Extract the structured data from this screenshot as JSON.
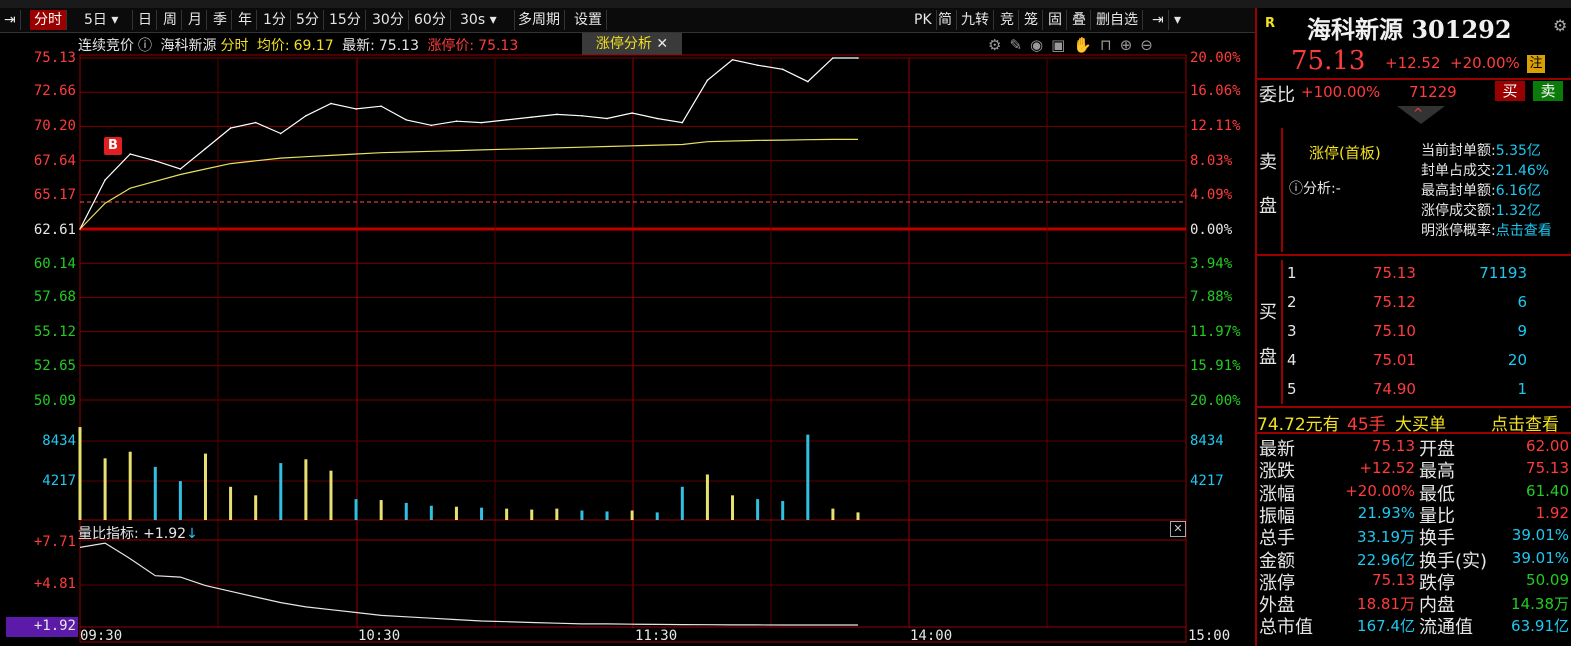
{
  "toolbar": {
    "items": [
      "分时",
      "5日",
      "日",
      "周",
      "月",
      "季",
      "年",
      "1分",
      "5分",
      "15分",
      "30分",
      "60分",
      "30s",
      "多周期",
      "设置"
    ],
    "right_items": [
      "PK",
      "简",
      "九转",
      "竞",
      "笼",
      "固",
      "叠",
      "删自选"
    ]
  },
  "infobar": {
    "auction": "连续竞价",
    "stock_name": "海科新源",
    "mode": "分时",
    "avg_label": "均价:",
    "avg_value": "69.17",
    "last_label": "最新:",
    "last_value": "75.13",
    "limit_label": "涨停价:",
    "limit_value": "75.13",
    "tab_label": "涨停分析"
  },
  "price_axis": {
    "left": [
      "75.13",
      "72.66",
      "70.20",
      "67.64",
      "65.17",
      "62.61",
      "60.14",
      "57.68",
      "55.12",
      "52.65",
      "50.09"
    ],
    "right": [
      "20.00%",
      "16.06%",
      "12.11%",
      "8.03%",
      "4.09%",
      "0.00%",
      "3.94%",
      "7.88%",
      "11.97%",
      "15.91%",
      "20.00%"
    ]
  },
  "volume_axis": {
    "left": [
      "8434",
      "4217"
    ],
    "right": [
      "8434",
      "4217"
    ]
  },
  "indicator": {
    "label": "量比指标: +1.92",
    "axis": [
      "+7.71",
      "+4.81",
      "+1.92"
    ]
  },
  "time_axis": [
    "09:30",
    "10:30",
    "11:30",
    "14:00",
    "15:00"
  ],
  "marker": "B",
  "panel": {
    "badge": "R",
    "name": "海科新源",
    "code": "301292",
    "price": "75.13",
    "change": "+12.52",
    "change_pct": "+20.00%",
    "zhu": "注",
    "weibi_label": "委比",
    "weibi_value": "+100.00%",
    "weibi_num": "71229",
    "buy_btn": "买",
    "sell_btn": "卖",
    "sell_label": [
      "卖",
      "盘"
    ],
    "limit_state": "涨停(首板)",
    "analysis_label": "分析:-",
    "seal_rows": [
      {
        "k": "当前封单额:",
        "v": "5.35亿"
      },
      {
        "k": "封单占成交:",
        "v": "21.46%"
      },
      {
        "k": "最高封单额:",
        "v": "6.16亿"
      },
      {
        "k": "涨停成交额:",
        "v": "1.32亿"
      },
      {
        "k": "明涨停概率:",
        "v": "点击查看"
      }
    ],
    "buy_label": [
      "买",
      "盘"
    ],
    "bids": [
      {
        "lvl": "1",
        "price": "75.13",
        "vol": "71193"
      },
      {
        "lvl": "2",
        "price": "75.12",
        "vol": "6"
      },
      {
        "lvl": "3",
        "price": "75.10",
        "vol": "9"
      },
      {
        "lvl": "4",
        "price": "75.01",
        "vol": "20"
      },
      {
        "lvl": "5",
        "price": "74.90",
        "vol": "1"
      }
    ],
    "big_order": {
      "amount": "74.72元有",
      "hands": "45手",
      "text": "大买单",
      "link": "点击查看"
    },
    "stats": [
      {
        "k1": "最新",
        "v1": "75.13",
        "c1": "red",
        "k2": "开盘",
        "v2": "62.00",
        "c2": "red"
      },
      {
        "k1": "涨跌",
        "v1": "+12.52",
        "c1": "red",
        "k2": "最高",
        "v2": "75.13",
        "c2": "red"
      },
      {
        "k1": "涨幅",
        "v1": "+20.00%",
        "c1": "red",
        "k2": "最低",
        "v2": "61.40",
        "c2": "green"
      },
      {
        "k1": "振幅",
        "v1": "21.93%",
        "c1": "cyan",
        "k2": "量比",
        "v2": "1.92",
        "c2": "red"
      },
      {
        "k1": "总手",
        "v1": "33.19万",
        "c1": "cyan",
        "k2": "换手",
        "v2": "39.01%",
        "c2": "cyan"
      },
      {
        "k1": "金额",
        "v1": "22.96亿",
        "c1": "cyan",
        "k2": "换手(实)",
        "v2": "39.01%",
        "c2": "cyan"
      },
      {
        "k1": "涨停",
        "v1": "75.13",
        "c1": "red",
        "k2": "跌停",
        "v2": "50.09",
        "c2": "green"
      },
      {
        "k1": "外盘",
        "v1": "18.81万",
        "c1": "red",
        "k2": "内盘",
        "v2": "14.38万",
        "c2": "green"
      },
      {
        "k1": "总市值",
        "v1": "167.4亿",
        "c1": "cyan",
        "k2": "流通值",
        "v2": "63.91亿",
        "c2": "cyan"
      }
    ]
  },
  "chart_data": {
    "type": "line",
    "price_series": {
      "x": [
        "09:30",
        "09:35",
        "09:40",
        "09:45",
        "09:50",
        "09:55",
        "10:00",
        "10:05",
        "10:10",
        "10:15",
        "10:20",
        "10:25",
        "10:30",
        "10:35",
        "10:40",
        "10:45",
        "10:50",
        "10:55",
        "11:00",
        "11:05",
        "11:10",
        "11:15",
        "11:20",
        "11:25",
        "11:30",
        "11:35",
        "11:40",
        "11:45",
        "11:50",
        "11:55",
        "13:00",
        "13:05"
      ],
      "values": [
        62.61,
        66.2,
        68.1,
        67.6,
        67.0,
        68.5,
        70.0,
        70.4,
        69.6,
        70.9,
        71.8,
        71.4,
        71.6,
        70.6,
        70.2,
        70.5,
        70.4,
        70.6,
        70.8,
        71.0,
        70.9,
        70.7,
        71.1,
        70.7,
        70.4,
        73.5,
        75.0,
        74.6,
        74.3,
        73.4,
        75.13,
        75.13
      ]
    },
    "avg_series": [
      62.61,
      64.5,
      65.6,
      66.1,
      66.6,
      67.0,
      67.4,
      67.6,
      67.8,
      67.9,
      68.0,
      68.1,
      68.2,
      68.25,
      68.3,
      68.35,
      68.4,
      68.45,
      68.5,
      68.55,
      68.6,
      68.65,
      68.7,
      68.75,
      68.8,
      69.0,
      69.05,
      69.1,
      69.12,
      69.15,
      69.17,
      69.17
    ],
    "volume": [
      9800,
      6500,
      7200,
      5600,
      4100,
      7000,
      3500,
      2600,
      6000,
      6400,
      5200,
      2200,
      2100,
      1800,
      1500,
      1400,
      1300,
      1200,
      1100,
      1200,
      1000,
      900,
      1000,
      800,
      3500,
      4800,
      2600,
      2200,
      2000,
      9000,
      1200,
      800
    ],
    "indicator_series": [
      7.4,
      7.7,
      6.6,
      5.4,
      5.3,
      4.7,
      4.3,
      3.9,
      3.5,
      3.2,
      3.0,
      2.8,
      2.6,
      2.5,
      2.4,
      2.3,
      2.2,
      2.15,
      2.1,
      2.05,
      2.0,
      2.0,
      1.98,
      1.96,
      1.95,
      1.94,
      1.93,
      1.93,
      1.92,
      1.92,
      1.92,
      1.92
    ],
    "ylim": [
      50.09,
      75.13
    ],
    "pre_close": 62.61,
    "volume_max": 12651,
    "indicator_range": [
      1.92,
      7.71
    ]
  }
}
